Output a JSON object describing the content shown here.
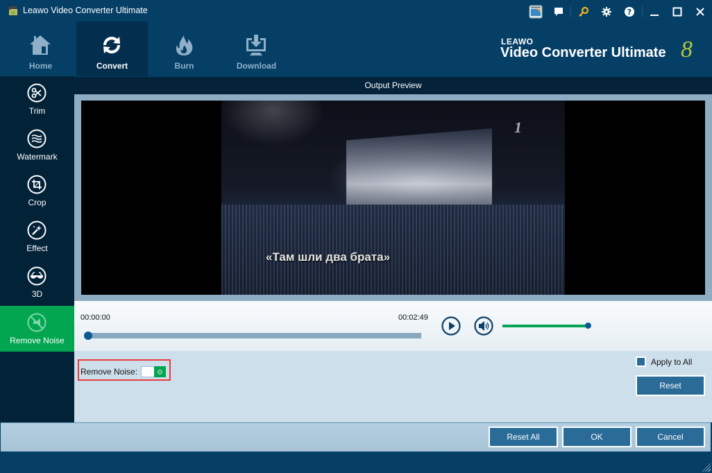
{
  "window": {
    "title": "Leawo Video Converter Ultimate",
    "controls": [
      {
        "name": "support-icon",
        "label": "Support"
      },
      {
        "name": "chat-icon",
        "label": "Feedback"
      },
      {
        "name": "key-icon",
        "label": "Register"
      },
      {
        "name": "gear-icon",
        "label": "Settings"
      },
      {
        "name": "help-icon",
        "label": "Help"
      },
      {
        "name": "minimize-icon",
        "label": "Minimize"
      },
      {
        "name": "maximize-icon",
        "label": "Maximize"
      },
      {
        "name": "close-icon",
        "label": "Close"
      }
    ]
  },
  "nav": {
    "tabs": [
      {
        "label": "Home",
        "icon": "home-icon",
        "active": false
      },
      {
        "label": "Convert",
        "icon": "convert-icon",
        "active": true
      },
      {
        "label": "Burn",
        "icon": "flame-icon",
        "active": false
      },
      {
        "label": "Download",
        "icon": "download-icon",
        "active": false
      }
    ],
    "brand_small": "LEAWO",
    "brand_big": "Video Converter Ultimate",
    "brand_version": "8"
  },
  "sidebar": {
    "items": [
      {
        "label": "Trim",
        "icon": "scissors-icon",
        "active": false
      },
      {
        "label": "Watermark",
        "icon": "watermark-icon",
        "active": false
      },
      {
        "label": "Crop",
        "icon": "crop-icon",
        "active": false
      },
      {
        "label": "Effect",
        "icon": "effect-icon",
        "active": false
      },
      {
        "label": "3D",
        "icon": "3d-glasses-icon",
        "active": false
      },
      {
        "label": "Remove Noise",
        "icon": "remove-noise-icon",
        "active": true
      }
    ]
  },
  "preview": {
    "header": "Output Preview",
    "subtitle": "«Там шли два брата»"
  },
  "player": {
    "time_start": "00:00:00",
    "time_end": "00:02:49",
    "position_fraction": 0.0,
    "volume_fraction": 1.0
  },
  "settings": {
    "remove_noise_label": "Remove Noise:",
    "remove_noise_on": true,
    "apply_to_all_label": "Apply to All",
    "apply_to_all_checked": true,
    "reset_label": "Reset"
  },
  "footer": {
    "reset_all_label": "Reset All",
    "ok_label": "OK",
    "cancel_label": "Cancel"
  },
  "colors": {
    "accent_green": "#02a650",
    "titlebar_blue": "#053f66",
    "button_blue": "#2a6b98",
    "highlight_red": "#e93a3a"
  }
}
